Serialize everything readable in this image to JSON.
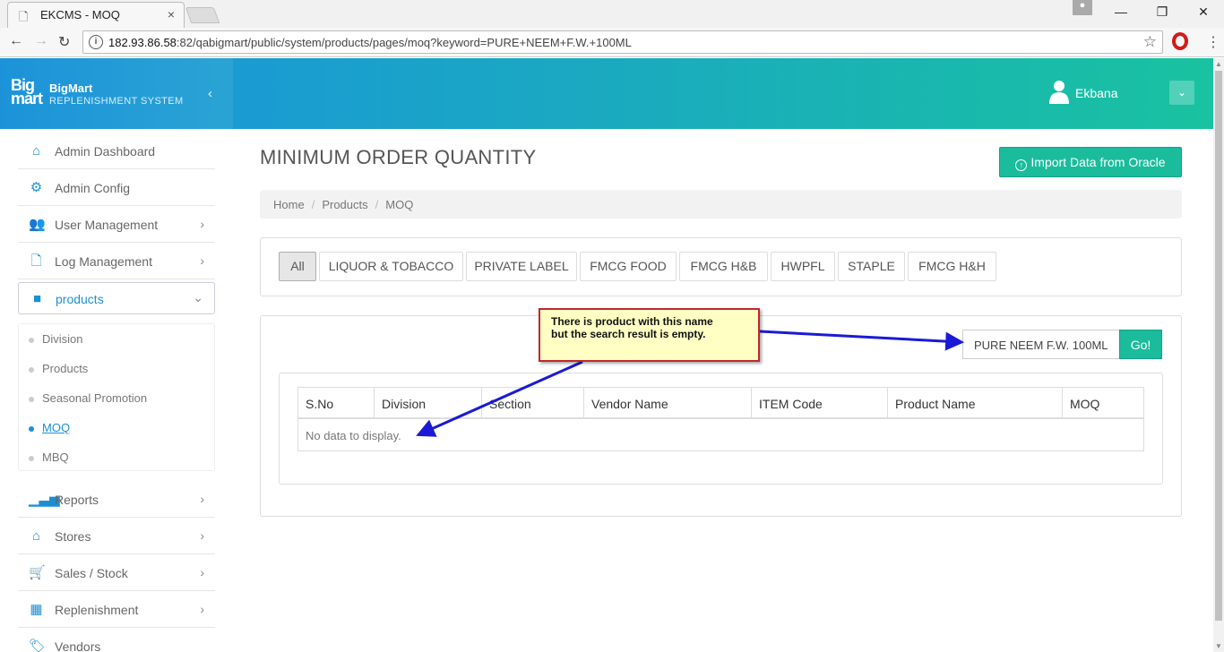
{
  "browser": {
    "tab_title": "EKCMS - MOQ",
    "tab_close": "×",
    "url_host": "182.93.86.58",
    "url_rest": ":82/qabigmart/public/system/products/pages/moq?keyword=PURE+NEEM+F.W.+100ML",
    "win_min": "—",
    "win_max": "❐",
    "win_close": "✕"
  },
  "brand": {
    "logo": "Big\nmart",
    "name": "BigMart",
    "subtitle": "REPLENISHMENT SYSTEM"
  },
  "user": {
    "name": "Ekbana"
  },
  "sidebar": {
    "items": [
      {
        "label": "Admin Dashboard",
        "icon": "home-icon"
      },
      {
        "label": "Admin Config",
        "icon": "gear-icon"
      },
      {
        "label": "User Management",
        "icon": "users-icon"
      },
      {
        "label": "Log Management",
        "icon": "file-icon"
      },
      {
        "label": "products",
        "icon": "briefcase-icon"
      }
    ],
    "submenu": [
      "Division",
      "Products",
      "Seasonal Promotion",
      "MOQ",
      "MBQ"
    ],
    "bottom_items": [
      {
        "label": "Reports",
        "icon": "bar-chart-icon"
      },
      {
        "label": "Stores",
        "icon": "home-icon"
      },
      {
        "label": "Sales / Stock",
        "icon": "cart-icon"
      },
      {
        "label": "Replenishment",
        "icon": "calendar-icon"
      },
      {
        "label": "Vendors",
        "icon": "tags-icon"
      }
    ]
  },
  "page": {
    "title": "MINIMUM ORDER QUANTITY",
    "import_button": "Import Data from Oracle",
    "breadcrumb": [
      "Home",
      "Products",
      "MOQ"
    ],
    "filters": [
      "All",
      "LIQUOR & TOBACCO",
      "PRIVATE LABEL",
      "FMCG FOOD",
      "FMCG H&B",
      "HWPFL",
      "STAPLE",
      "FMCG H&H"
    ],
    "active_filter": "All",
    "search_value": "PURE NEEM F.W. 100ML",
    "go_button": "Go!",
    "table_columns": [
      "S.No",
      "Division",
      "Section",
      "Vendor Name",
      "ITEM Code",
      "Product Name",
      "MOQ"
    ],
    "empty_message": "No data to display."
  },
  "annotation": {
    "line1": "There is product with this name",
    "line2": "but the search result is empty."
  },
  "colors": {
    "accent": "#1c8fd4",
    "button": "#1abc9c",
    "callout_bg": "#ffffc4",
    "callout_border": "#c0272d",
    "arrow": "#1a1ad6"
  }
}
